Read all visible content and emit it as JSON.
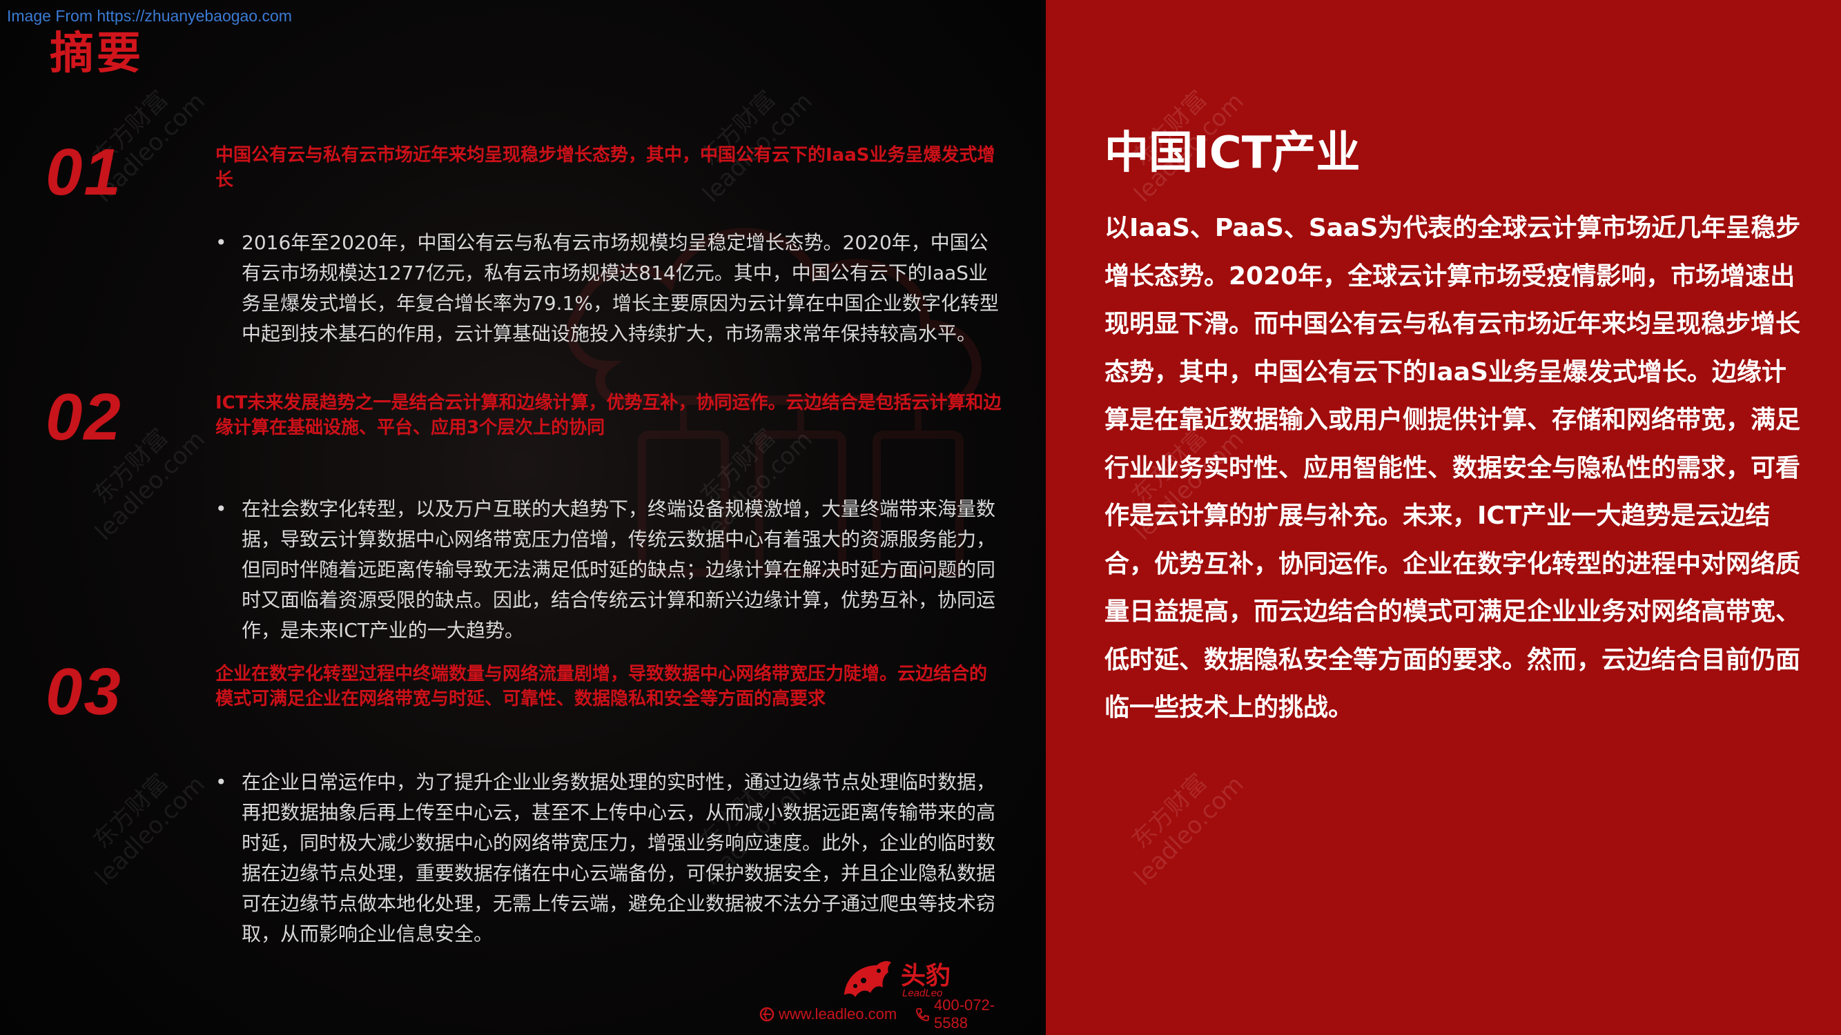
{
  "source_line": "Image From https://zhuanyebaogao.com",
  "title": "摘要",
  "watermark": {
    "line1": "东方财富",
    "line2": "leadleo.com"
  },
  "sections": [
    {
      "number": "01",
      "heading": "中国公有云与私有云市场近年来均呈现稳步增长态势，其中，中国公有云下的IaaS业务呈爆发式增长",
      "bullet": "2016年至2020年，中国公有云与私有云市场规模均呈稳定增长态势。2020年，中国公有云市场规模达1277亿元，私有云市场规模达814亿元。其中，中国公有云下的IaaS业务呈爆发式增长，年复合增长率为79.1%，增长主要原因为云计算在中国企业数字化转型中起到技术基石的作用，云计算基础设施投入持续扩大，市场需求常年保持较高水平。"
    },
    {
      "number": "02",
      "heading": "ICT未来发展趋势之一是结合云计算和边缘计算，优势互补，协同运作。云边结合是包括云计算和边缘计算在基础设施、平台、应用3个层次上的协同",
      "bullet": "在社会数字化转型，以及万户互联的大趋势下，终端设备规模激增，大量终端带来海量数据，导致云计算数据中心网络带宽压力倍增，传统云数据中心有着强大的资源服务能力，但同时伴随着远距离传输导致无法满足低时延的缺点；边缘计算在解决时延方面问题的同时又面临着资源受限的缺点。因此，结合传统云计算和新兴边缘计算，优势互补，协同运作，是未来ICT产业的一大趋势。"
    },
    {
      "number": "03",
      "heading": "企业在数字化转型过程中终端数量与网络流量剧增，导致数据中心网络带宽压力陡增。云边结合的模式可满足企业在网络带宽与时延、可靠性、数据隐私和安全等方面的高要求",
      "bullet": "在企业日常运作中，为了提升企业业务数据处理的实时性，通过边缘节点处理临时数据，再把数据抽象后再上传至中心云，甚至不上传中心云，从而减小数据远距离传输带来的高时延，同时极大减少数据中心的网络带宽压力，增强业务响应速度。此外，企业的临时数据在边缘节点处理，重要数据存储在中心云端备份，可保护数据安全，并且企业隐私数据可在边缘节点做本地化处理，无需上传云端，避免企业数据被不法分子通过爬虫等技术窃取，从而影响企业信息安全。"
    }
  ],
  "logo": {
    "brand": "头豹",
    "sub": "LeadLeo"
  },
  "footer": {
    "website": "www.leadleo.com",
    "phone": "400-072-5588"
  },
  "right": {
    "title": "中国ICT产业",
    "body": "以IaaS、PaaS、SaaS为代表的全球云计算市场近几年呈稳步增长态势。2020年，全球云计算市场受疫情影响，市场增速出现明显下滑。而中国公有云与私有云市场近年来均呈现稳步增长态势，其中，中国公有云下的IaaS业务呈爆发式增长。边缘计算是在靠近数据输入或用户侧提供计算、存储和网络带宽，满足行业业务实时性、应用智能性、数据安全与隐私性的需求，可看作是云计算的扩展与补充。未来，ICT产业一大趋势是云边结合，优势互补，协同运作。企业在数字化转型的进程中对网络质量日益提高，而云边结合的模式可满足企业业务对网络高带宽、低时延、数据隐私安全等方面的要求。然而，云边结合目前仍面临一些技术上的挑战。"
  },
  "colors": {
    "accent_red": "#c8141b",
    "right_panel": "#a10c0c",
    "left_panel": "#050505",
    "source_link": "#3a7bd5"
  }
}
